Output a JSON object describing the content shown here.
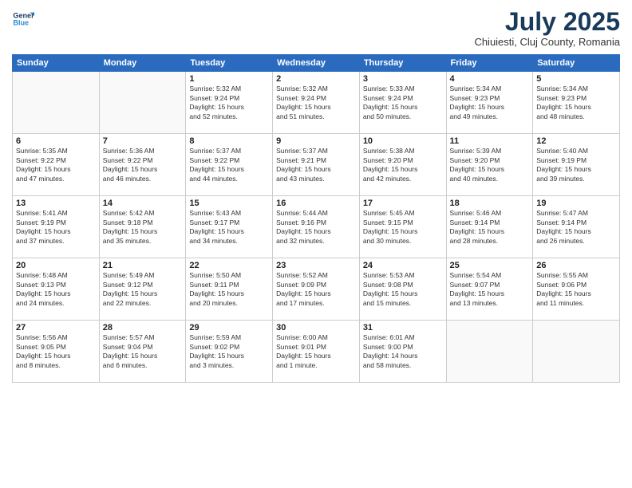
{
  "header": {
    "logo_line1": "General",
    "logo_line2": "Blue",
    "month_title": "July 2025",
    "subtitle": "Chiuiesti, Cluj County, Romania"
  },
  "weekdays": [
    "Sunday",
    "Monday",
    "Tuesday",
    "Wednesday",
    "Thursday",
    "Friday",
    "Saturday"
  ],
  "weeks": [
    [
      {
        "day": "",
        "info": ""
      },
      {
        "day": "",
        "info": ""
      },
      {
        "day": "1",
        "info": "Sunrise: 5:32 AM\nSunset: 9:24 PM\nDaylight: 15 hours\nand 52 minutes."
      },
      {
        "day": "2",
        "info": "Sunrise: 5:32 AM\nSunset: 9:24 PM\nDaylight: 15 hours\nand 51 minutes."
      },
      {
        "day": "3",
        "info": "Sunrise: 5:33 AM\nSunset: 9:24 PM\nDaylight: 15 hours\nand 50 minutes."
      },
      {
        "day": "4",
        "info": "Sunrise: 5:34 AM\nSunset: 9:23 PM\nDaylight: 15 hours\nand 49 minutes."
      },
      {
        "day": "5",
        "info": "Sunrise: 5:34 AM\nSunset: 9:23 PM\nDaylight: 15 hours\nand 48 minutes."
      }
    ],
    [
      {
        "day": "6",
        "info": "Sunrise: 5:35 AM\nSunset: 9:22 PM\nDaylight: 15 hours\nand 47 minutes."
      },
      {
        "day": "7",
        "info": "Sunrise: 5:36 AM\nSunset: 9:22 PM\nDaylight: 15 hours\nand 46 minutes."
      },
      {
        "day": "8",
        "info": "Sunrise: 5:37 AM\nSunset: 9:22 PM\nDaylight: 15 hours\nand 44 minutes."
      },
      {
        "day": "9",
        "info": "Sunrise: 5:37 AM\nSunset: 9:21 PM\nDaylight: 15 hours\nand 43 minutes."
      },
      {
        "day": "10",
        "info": "Sunrise: 5:38 AM\nSunset: 9:20 PM\nDaylight: 15 hours\nand 42 minutes."
      },
      {
        "day": "11",
        "info": "Sunrise: 5:39 AM\nSunset: 9:20 PM\nDaylight: 15 hours\nand 40 minutes."
      },
      {
        "day": "12",
        "info": "Sunrise: 5:40 AM\nSunset: 9:19 PM\nDaylight: 15 hours\nand 39 minutes."
      }
    ],
    [
      {
        "day": "13",
        "info": "Sunrise: 5:41 AM\nSunset: 9:19 PM\nDaylight: 15 hours\nand 37 minutes."
      },
      {
        "day": "14",
        "info": "Sunrise: 5:42 AM\nSunset: 9:18 PM\nDaylight: 15 hours\nand 35 minutes."
      },
      {
        "day": "15",
        "info": "Sunrise: 5:43 AM\nSunset: 9:17 PM\nDaylight: 15 hours\nand 34 minutes."
      },
      {
        "day": "16",
        "info": "Sunrise: 5:44 AM\nSunset: 9:16 PM\nDaylight: 15 hours\nand 32 minutes."
      },
      {
        "day": "17",
        "info": "Sunrise: 5:45 AM\nSunset: 9:15 PM\nDaylight: 15 hours\nand 30 minutes."
      },
      {
        "day": "18",
        "info": "Sunrise: 5:46 AM\nSunset: 9:14 PM\nDaylight: 15 hours\nand 28 minutes."
      },
      {
        "day": "19",
        "info": "Sunrise: 5:47 AM\nSunset: 9:14 PM\nDaylight: 15 hours\nand 26 minutes."
      }
    ],
    [
      {
        "day": "20",
        "info": "Sunrise: 5:48 AM\nSunset: 9:13 PM\nDaylight: 15 hours\nand 24 minutes."
      },
      {
        "day": "21",
        "info": "Sunrise: 5:49 AM\nSunset: 9:12 PM\nDaylight: 15 hours\nand 22 minutes."
      },
      {
        "day": "22",
        "info": "Sunrise: 5:50 AM\nSunset: 9:11 PM\nDaylight: 15 hours\nand 20 minutes."
      },
      {
        "day": "23",
        "info": "Sunrise: 5:52 AM\nSunset: 9:09 PM\nDaylight: 15 hours\nand 17 minutes."
      },
      {
        "day": "24",
        "info": "Sunrise: 5:53 AM\nSunset: 9:08 PM\nDaylight: 15 hours\nand 15 minutes."
      },
      {
        "day": "25",
        "info": "Sunrise: 5:54 AM\nSunset: 9:07 PM\nDaylight: 15 hours\nand 13 minutes."
      },
      {
        "day": "26",
        "info": "Sunrise: 5:55 AM\nSunset: 9:06 PM\nDaylight: 15 hours\nand 11 minutes."
      }
    ],
    [
      {
        "day": "27",
        "info": "Sunrise: 5:56 AM\nSunset: 9:05 PM\nDaylight: 15 hours\nand 8 minutes."
      },
      {
        "day": "28",
        "info": "Sunrise: 5:57 AM\nSunset: 9:04 PM\nDaylight: 15 hours\nand 6 minutes."
      },
      {
        "day": "29",
        "info": "Sunrise: 5:59 AM\nSunset: 9:02 PM\nDaylight: 15 hours\nand 3 minutes."
      },
      {
        "day": "30",
        "info": "Sunrise: 6:00 AM\nSunset: 9:01 PM\nDaylight: 15 hours\nand 1 minute."
      },
      {
        "day": "31",
        "info": "Sunrise: 6:01 AM\nSunset: 9:00 PM\nDaylight: 14 hours\nand 58 minutes."
      },
      {
        "day": "",
        "info": ""
      },
      {
        "day": "",
        "info": ""
      }
    ]
  ]
}
